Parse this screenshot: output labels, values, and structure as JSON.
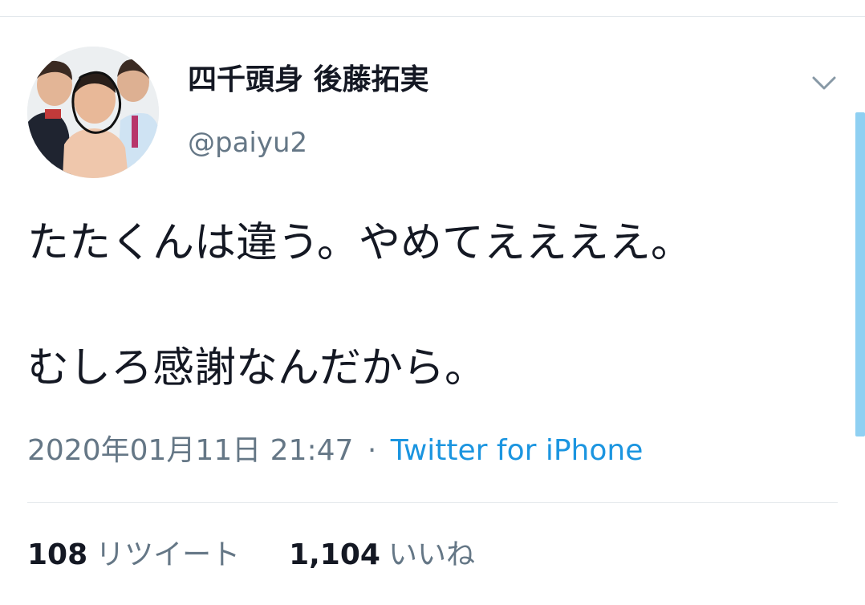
{
  "tweet": {
    "author": {
      "display_name": "四千頭身 後藤拓実",
      "handle": "@paiyu2"
    },
    "text_lines": [
      "たたくんは違う。やめてええええ。",
      "",
      "むしろ感謝なんだから。"
    ],
    "timestamp": "2020年01月11日 21:47",
    "separator": "·",
    "source": "Twitter for iPhone",
    "retweets": {
      "count": "108",
      "label": "リツイート"
    },
    "likes": {
      "count": "1,104",
      "label": "いいね"
    }
  },
  "icons": {
    "menu": "chevron-down-icon",
    "avatar": "profile-photo"
  },
  "colors": {
    "text": "#141823",
    "secondary": "#657786",
    "link": "#1b95e0",
    "divider": "#e3e8ec",
    "scrollbar": "#8fd0f2"
  }
}
